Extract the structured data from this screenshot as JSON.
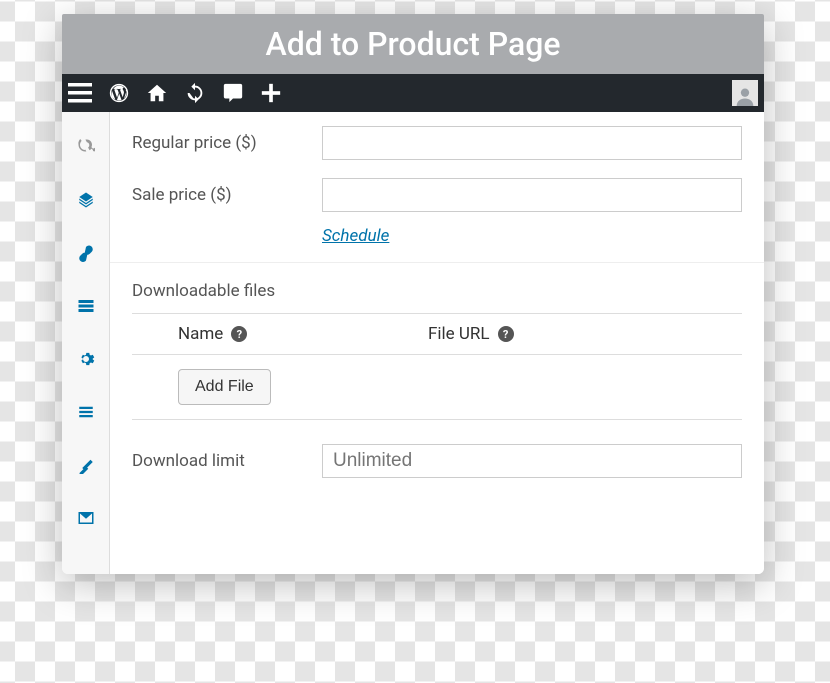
{
  "header": {
    "title": "Add to Product Page"
  },
  "fields": {
    "regular_price": {
      "label": "Regular price ($)",
      "value": ""
    },
    "sale_price": {
      "label": "Sale price ($)",
      "value": ""
    },
    "schedule_link": "Schedule",
    "downloadable_title": "Downloadable files",
    "table": {
      "name_header": "Name",
      "url_header": "File URL"
    },
    "add_file_button": "Add File",
    "download_limit": {
      "label": "Download limit",
      "placeholder": "Unlimited",
      "value": ""
    }
  }
}
